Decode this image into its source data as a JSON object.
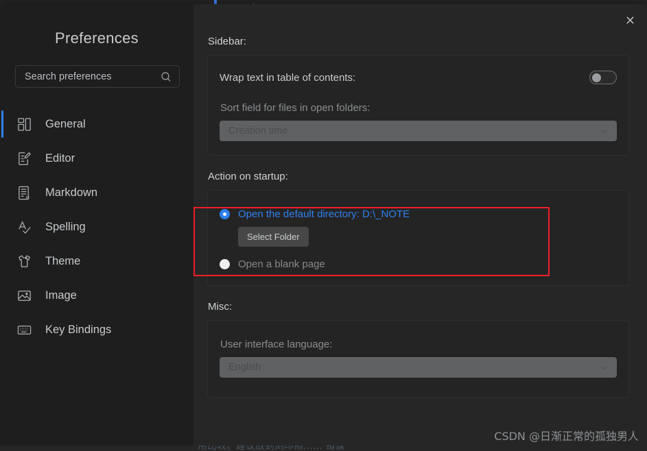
{
  "window": {
    "tab_marker_color": "#3b82f6",
    "bottom_cut_text": "用比较。建议放到刻印照…… 错误"
  },
  "dialog": {
    "title": "Preferences",
    "close_icon": "close-icon"
  },
  "search": {
    "placeholder": "Search preferences",
    "value": "",
    "icon": "search-icon"
  },
  "sidebar": {
    "items": [
      {
        "label": "General",
        "icon": "layout-blocks-icon",
        "active": true
      },
      {
        "label": "Editor",
        "icon": "edit-document-icon",
        "active": false
      },
      {
        "label": "Markdown",
        "icon": "markdown-file-icon",
        "active": false
      },
      {
        "label": "Spelling",
        "icon": "spellcheck-icon",
        "active": false
      },
      {
        "label": "Theme",
        "icon": "tshirt-icon",
        "active": false
      },
      {
        "label": "Image",
        "icon": "image-icon",
        "active": false
      },
      {
        "label": "Key Bindings",
        "icon": "keyboard-icon",
        "active": false
      }
    ],
    "active_indicator_color": "#2f80ed"
  },
  "sections": {
    "sidebar": {
      "heading": "Sidebar:",
      "wrap_text_label": "Wrap text in table of contents:",
      "wrap_text_enabled": false,
      "sort_field_label": "Sort field for files in open folders:",
      "sort_field_value": "Creation time"
    },
    "startup": {
      "heading": "Action on startup:",
      "options": [
        {
          "label": "Open the default directory: D:\\_NOTE",
          "selected": true
        },
        {
          "label": "Open a blank page",
          "selected": false
        }
      ],
      "select_folder_label": "Select Folder",
      "selected_color": "#2f80ed"
    },
    "misc": {
      "heading": "Misc:",
      "language_label": "User interface language:",
      "language_value": "English"
    }
  },
  "annotation": {
    "highlight_color": "#f01e28"
  },
  "watermark": {
    "text": "CSDN @日渐正常的孤独男人"
  }
}
